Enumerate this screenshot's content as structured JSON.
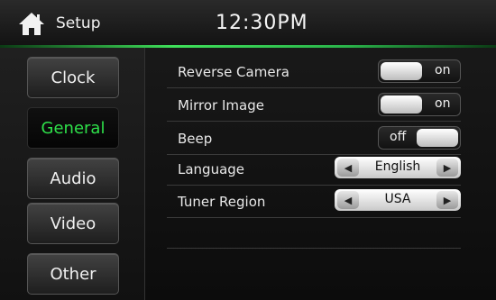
{
  "header": {
    "title": "Setup",
    "time": "12:30PM"
  },
  "sidebar": {
    "items": [
      {
        "label": "Clock",
        "active": false
      },
      {
        "label": "General",
        "active": true
      },
      {
        "label": "Audio",
        "active": false
      },
      {
        "label": "Video",
        "active": false
      },
      {
        "label": "Other",
        "active": false
      }
    ]
  },
  "settings": {
    "reverse_camera": {
      "label": "Reverse Camera",
      "state": "on"
    },
    "mirror_image": {
      "label": "Mirror Image",
      "state": "on"
    },
    "beep": {
      "label": "Beep",
      "state": "off"
    },
    "language": {
      "label": "Language",
      "value": "English"
    },
    "tuner_region": {
      "label": "Tuner Region",
      "value": "USA"
    }
  },
  "colors": {
    "accent": "#2ee04a"
  }
}
